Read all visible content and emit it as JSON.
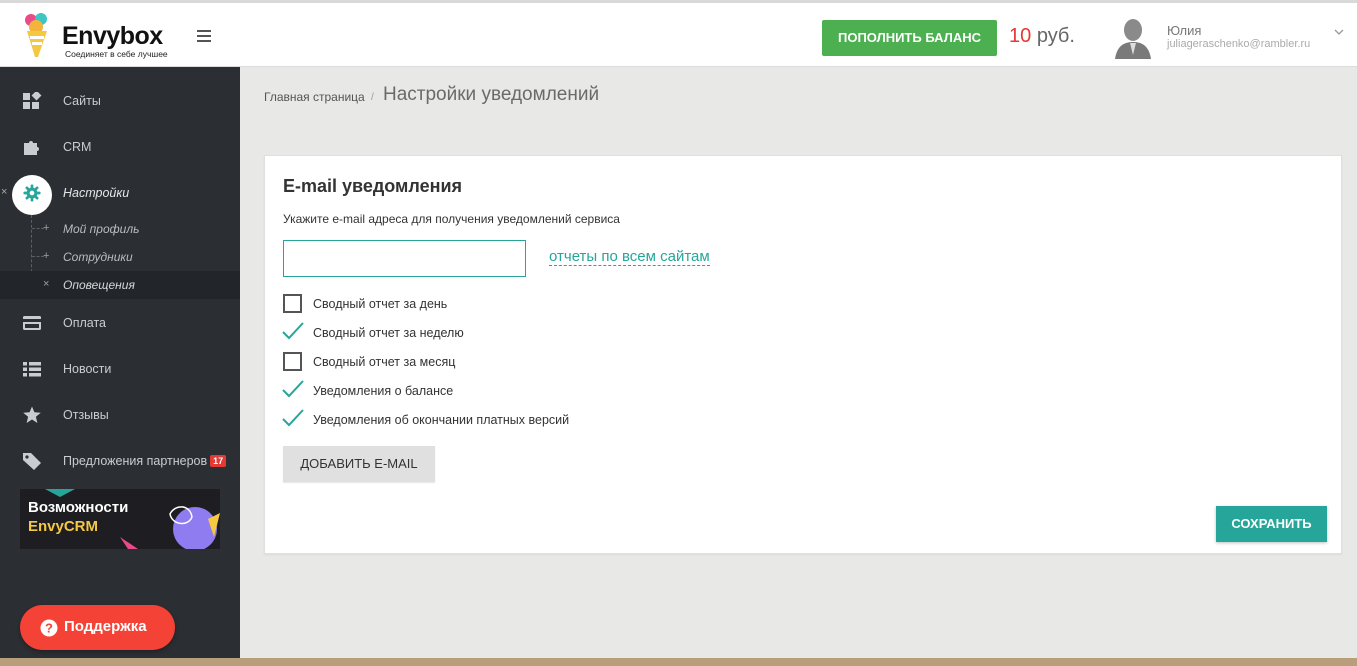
{
  "header": {
    "logo_text": "Envybox",
    "logo_tagline": "Соединяет в себе лучшее",
    "topup_button": "ПОПОЛНИТЬ БАЛАНС",
    "balance_amount": "10",
    "balance_currency": "руб.",
    "user_name": "Юлия",
    "user_email": "juliageraschenko@rambler.ru"
  },
  "sidebar": {
    "items": [
      {
        "label": "Сайты",
        "icon": "dashboard-icon"
      },
      {
        "label": "CRM",
        "icon": "puzzle-icon"
      },
      {
        "label": "Настройки",
        "icon": "gear-icon"
      },
      {
        "label": "Оплата",
        "icon": "credit-card-icon"
      },
      {
        "label": "Новости",
        "icon": "list-icon"
      },
      {
        "label": "Отзывы",
        "icon": "star-icon"
      },
      {
        "label": "Предложения партнеров",
        "icon": "tag-icon",
        "badge": "17"
      }
    ],
    "settings_subitems": [
      {
        "label": "Мой профиль"
      },
      {
        "label": "Сотрудники"
      },
      {
        "label": "Оповещения"
      }
    ],
    "promo": {
      "title": "Возможности",
      "subtitle": "EnvyCRM"
    },
    "support_button": "Поддержка"
  },
  "breadcrumb": {
    "home": "Главная страница",
    "separator": "/",
    "current": "Настройки уведомлений"
  },
  "card": {
    "title": "E-mail уведомления",
    "description": "Укажите e-mail адреса для получения уведомлений сервиса",
    "email_value": "",
    "reports_link": "отчеты по всем сайтам",
    "options": [
      {
        "label": "Сводный отчет за день",
        "checked": false
      },
      {
        "label": "Сводный отчет за неделю",
        "checked": true
      },
      {
        "label": "Сводный отчет за месяц",
        "checked": false
      },
      {
        "label": "Уведомления о балансе",
        "checked": true
      },
      {
        "label": "Уведомления об окончании платных версий",
        "checked": true
      }
    ],
    "add_button": "ДОБАВИТЬ E-MAIL",
    "save_button": "СОХРАНИТЬ"
  },
  "colors": {
    "accent": "#26a69a",
    "topup": "#4caf50",
    "danger": "#f44336",
    "sidebar_bg": "#2b2f33"
  }
}
